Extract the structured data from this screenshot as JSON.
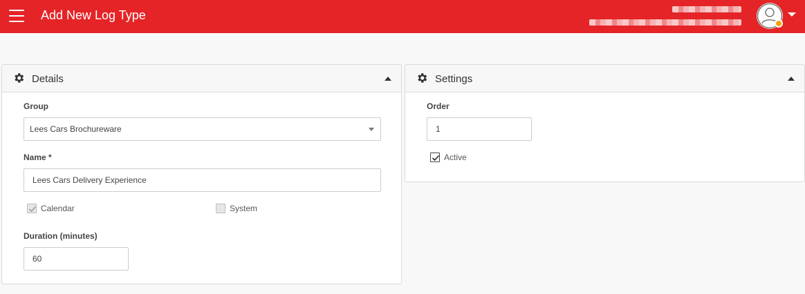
{
  "header": {
    "title": "Add New Log Type",
    "brand_color": "#e42427"
  },
  "details_panel": {
    "title": "Details",
    "group": {
      "label": "Group",
      "value": "Lees Cars Brochureware"
    },
    "name": {
      "label": "Name *",
      "value": "Lees Cars Delivery Experience"
    },
    "calendar": {
      "label": "Calendar",
      "checked": true,
      "disabled": true
    },
    "system": {
      "label": "System",
      "checked": false,
      "disabled": true
    },
    "duration": {
      "label": "Duration (minutes)",
      "value": "60"
    }
  },
  "settings_panel": {
    "title": "Settings",
    "order": {
      "label": "Order",
      "value": "1"
    },
    "active": {
      "label": "Active",
      "checked": true
    }
  },
  "icons": {
    "menu": "hamburger-menu-icon",
    "avatar": "user-avatar-icon",
    "panel": "gear-icon",
    "collapse": "caret-up-icon",
    "user_menu": "caret-down-icon"
  },
  "status_color": "#f7a400"
}
